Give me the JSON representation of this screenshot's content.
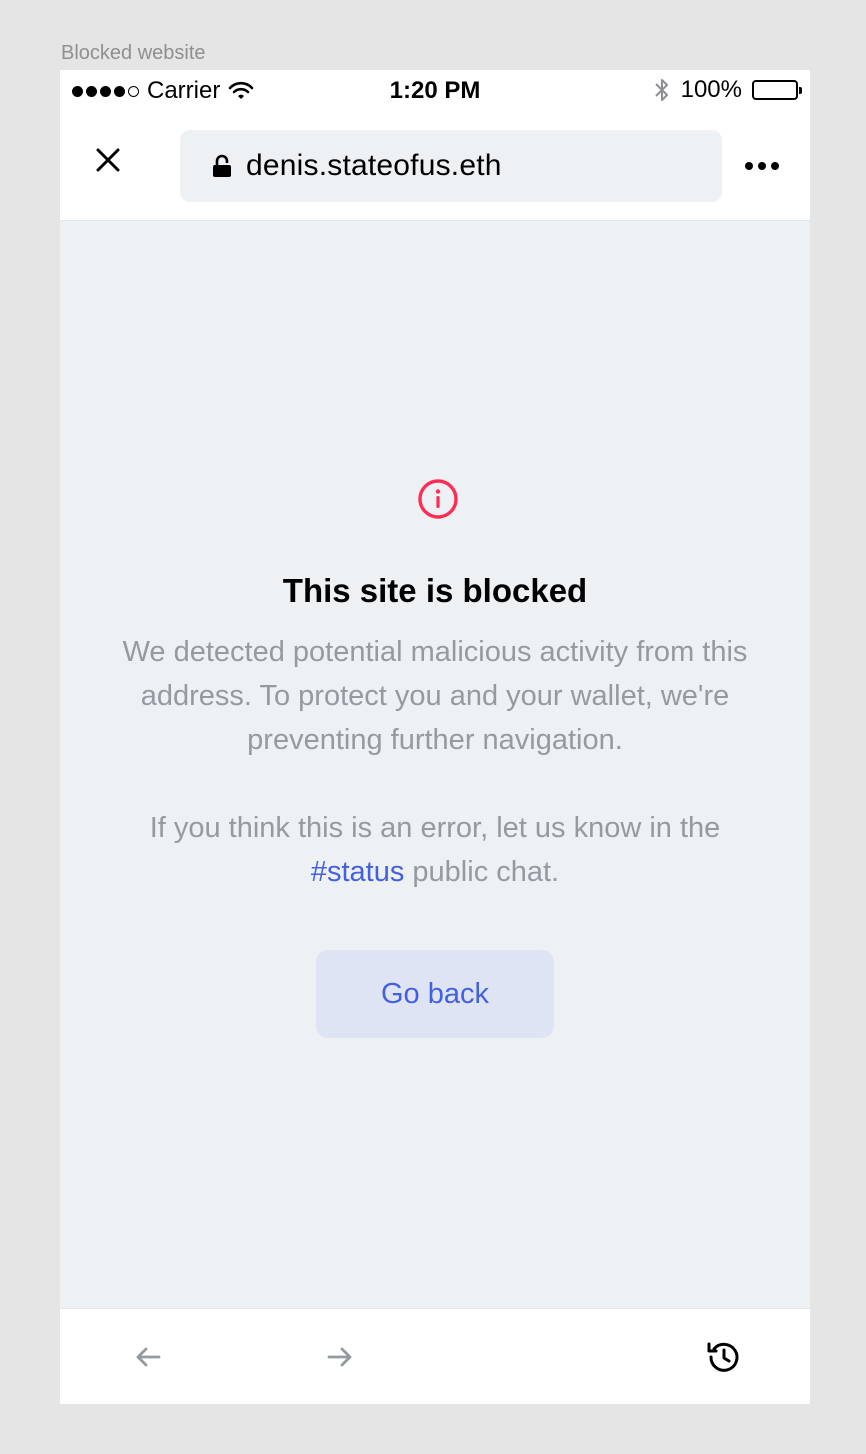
{
  "frame_label": "Blocked website",
  "status_bar": {
    "carrier": "Carrier",
    "time": "1:20 PM",
    "battery": "100%"
  },
  "header": {
    "url": "denis.stateofus.eth"
  },
  "content": {
    "title": "This site is blocked",
    "description": "We detected potential malicious activity from this address. To protect you and your wallet, we're preventing further navigation.",
    "hint_before": "If you think this is an error, let us know in the ",
    "hint_link": "#status",
    "hint_after": " public chat.",
    "go_back_label": "Go back"
  },
  "icons": {
    "close": "close-icon",
    "lock": "lock-icon",
    "more": "more-icon",
    "info": "info-icon",
    "back": "arrow-left-icon",
    "forward": "arrow-right-icon",
    "reload": "reload-icon"
  },
  "colors": {
    "accent": "#4360df",
    "danger": "#ff2d55",
    "muted_text": "#939ba1",
    "content_bg": "#eef1f4",
    "button_bg": "#dfe4f4"
  }
}
